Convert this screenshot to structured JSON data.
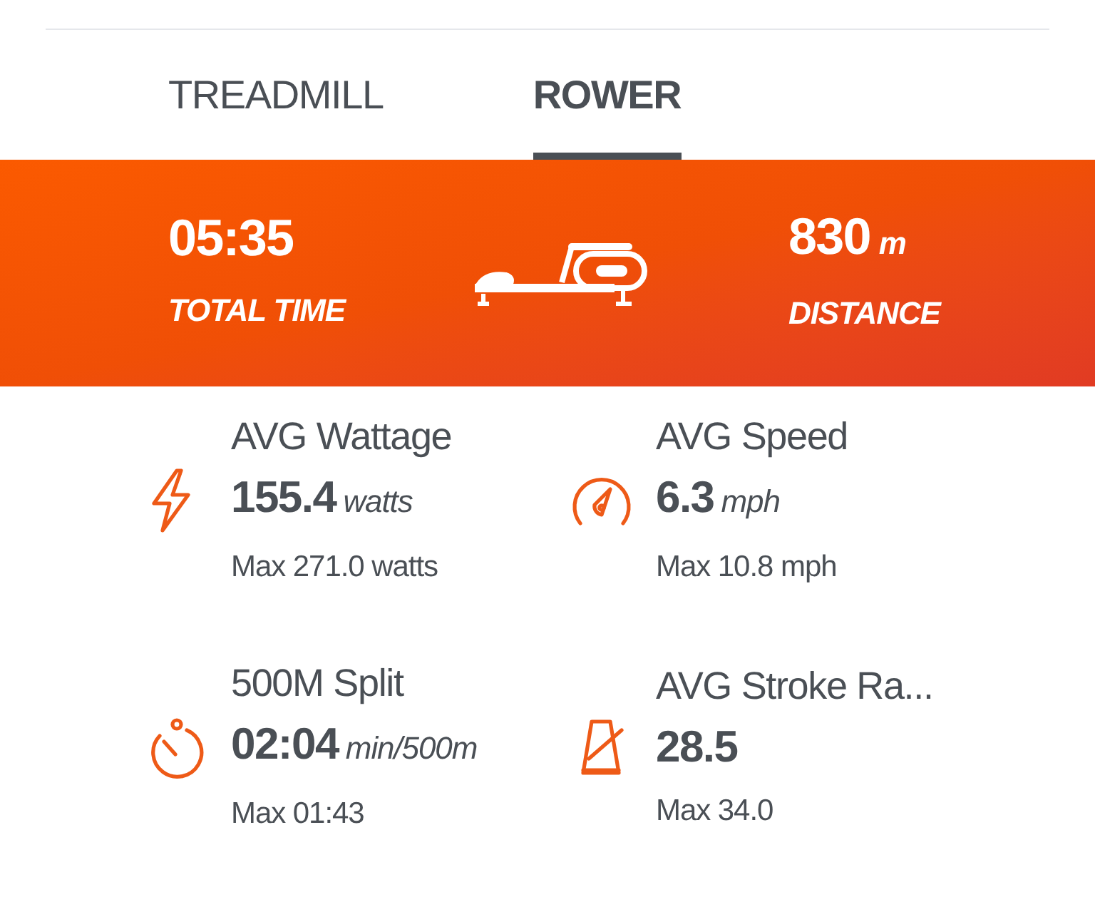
{
  "tabs": [
    {
      "label": "TREADMILL",
      "selected": false
    },
    {
      "label": "ROWER",
      "selected": true
    }
  ],
  "summary": {
    "left": {
      "value": "05:35",
      "label": "TOTAL TIME"
    },
    "right": {
      "value": "830",
      "unit": "m",
      "label": "DISTANCE"
    }
  },
  "stats": [
    {
      "kind": "power",
      "title": "AVG Wattage",
      "value": "155.4",
      "unit": "watts",
      "max": "Max 271.0 watts"
    },
    {
      "kind": "speed",
      "title": "AVG Speed",
      "value": "6.3",
      "unit": "mph",
      "max": "Max 10.8 mph"
    },
    {
      "kind": "split",
      "title": "500M Split",
      "value": "02:04",
      "unit": "min/500m",
      "max": "Max 01:43"
    },
    {
      "kind": "stroke",
      "title": "AVG Stroke Ra...",
      "value": "28.5",
      "max": "Max 34.0"
    }
  ]
}
